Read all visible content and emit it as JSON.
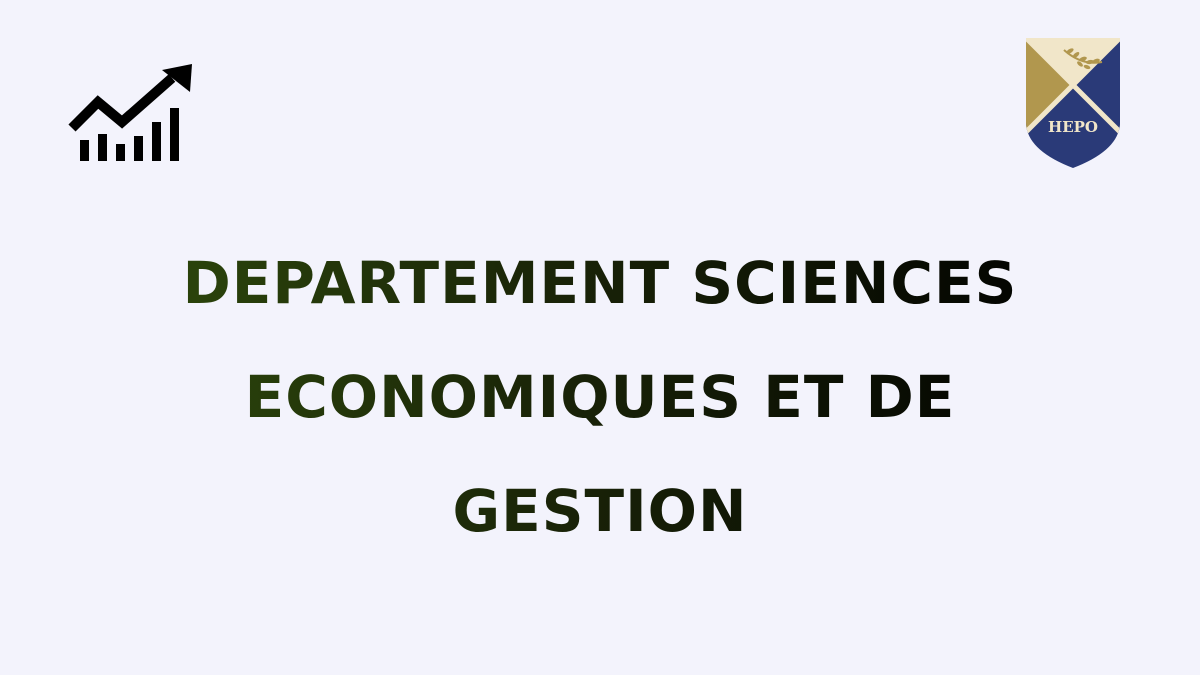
{
  "page": {
    "background_color": "#f3f3fc",
    "title": "DEPARTEMENT SCIENCES ECONOMIQUES ET DE GESTION",
    "title_colors": [
      "#2e4a0c",
      "#000000"
    ]
  },
  "icons": {
    "left": "growth-chart-icon"
  },
  "logo": {
    "text": "HEPO",
    "colors": {
      "gold": "#b1974e",
      "navy": "#2a3a78",
      "cream": "#f1e6c9"
    }
  }
}
